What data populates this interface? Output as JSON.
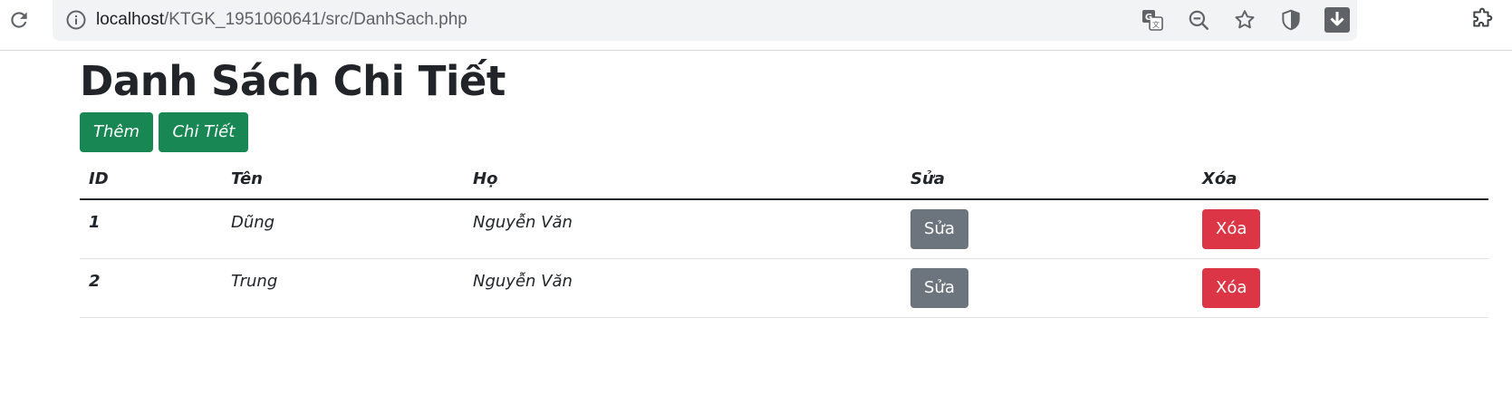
{
  "browser": {
    "url_host": "localhost",
    "url_path": "/KTGK_1951060641/src/DanhSach.php"
  },
  "page": {
    "title": "Danh Sách Chi Tiết",
    "buttons": {
      "add_label": "Thêm",
      "details_label": "Chi Tiết"
    }
  },
  "table": {
    "headers": {
      "id": "ID",
      "first": "Tên",
      "last": "Họ",
      "edit": "Sửa",
      "delete": "Xóa"
    },
    "rows": [
      {
        "id": "1",
        "first": "Dũng",
        "last": "Nguyễn Văn",
        "edit": "Sửa",
        "delete": "Xóa"
      },
      {
        "id": "2",
        "first": "Trung",
        "last": "Nguyễn Văn",
        "edit": "Sửa",
        "delete": "Xóa"
      }
    ]
  },
  "colors": {
    "success": "#198754",
    "secondary": "#6c757d",
    "danger": "#dc3545"
  }
}
